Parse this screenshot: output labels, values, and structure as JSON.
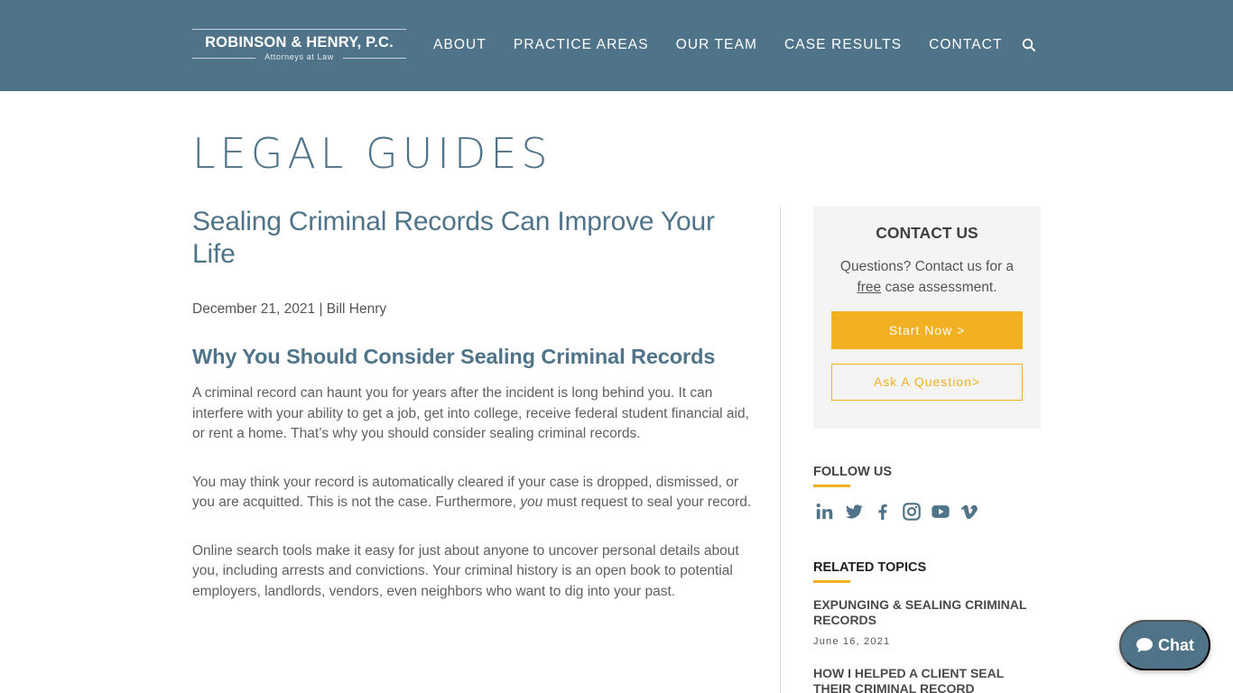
{
  "header": {
    "logo": {
      "name": "ROBINSON & HENRY, P.C.",
      "tagline": "Attorneys at Law"
    },
    "nav": [
      {
        "label": "ABOUT"
      },
      {
        "label": "PRACTICE AREAS"
      },
      {
        "label": "OUR TEAM"
      },
      {
        "label": "CASE RESULTS"
      },
      {
        "label": "CONTACT"
      }
    ],
    "search_icon": "search-icon"
  },
  "page": {
    "title": "LEGAL GUIDES"
  },
  "article": {
    "title": "Sealing Criminal Records Can Improve Your Life",
    "date": "December 21, 2021",
    "separator": " | ",
    "author": "Bill Henry",
    "heading": "Why You Should Consider Sealing Criminal Records",
    "paragraphs": [
      "A criminal record can haunt you for years after the incident is long behind you. It can interfere with your ability to get a job, get into college, receive federal student financial aid, or rent a home. That’s why you should consider sealing criminal records.",
      {
        "before": "You may think your record is automatically cleared if your case is dropped, dismissed, or you are acquitted. This is not the case. Furthermore, ",
        "emphasis": "you",
        "after": " must request to seal your record."
      },
      "Online search tools make it easy for just about anyone to uncover personal details about you, including arrests and convictions. Your criminal history is an open book to potential employers, landlords, vendors, even neighbors who want to dig into your past."
    ]
  },
  "sidebar": {
    "contact": {
      "title": "CONTACT US",
      "desc_before": "Questions? Contact us for a ",
      "desc_underlined": "free",
      "desc_after": " case assessment.",
      "start_label": "Start Now >",
      "ask_label": "Ask A Question>"
    },
    "follow": {
      "title": "FOLLOW US",
      "icons": [
        "linkedin-icon",
        "twitter-icon",
        "facebook-icon",
        "instagram-icon",
        "youtube-icon",
        "vimeo-icon"
      ]
    },
    "related": {
      "title": "RELATED TOPICS",
      "items": [
        {
          "title": "EXPUNGING & SEALING CRIMINAL RECORDS",
          "date": "June 16, 2021"
        },
        {
          "title": "HOW I HELPED A CLIENT SEAL THEIR CRIMINAL RECORD"
        }
      ]
    }
  },
  "chat": {
    "label": "Chat"
  },
  "colors": {
    "brand": "#4f7489",
    "accent": "#f2b023",
    "panel": "#f4f4f4"
  }
}
